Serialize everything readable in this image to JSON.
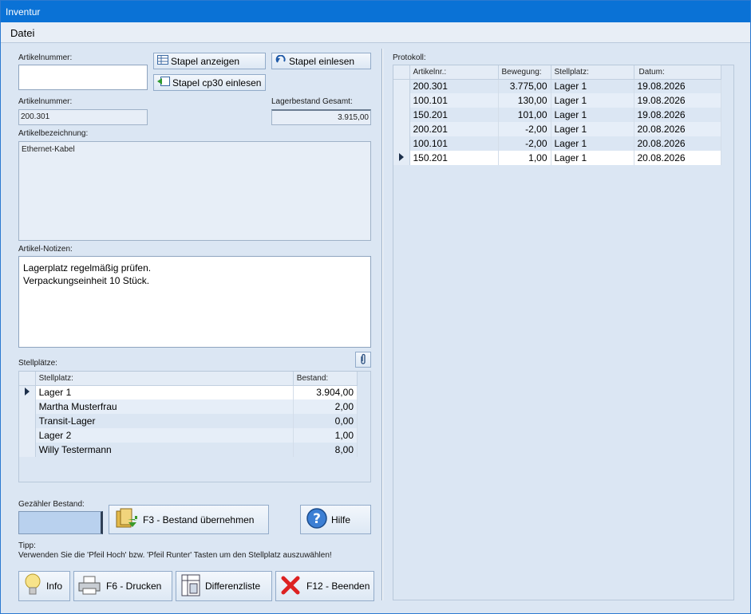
{
  "window": {
    "title": "Inventur"
  },
  "menu": {
    "datei": "Datei"
  },
  "left": {
    "artikelnummer_input_label": "Artikelnummer:",
    "btn_stapel_anzeigen": "Stapel anzeigen",
    "btn_stapel_einlesen": "Stapel einlesen",
    "btn_stapel_cp30": "Stapel cp30 einlesen",
    "artikelnummer_label": "Artikelnummer:",
    "artikelnummer_value": "200.301",
    "lagerbestand_label": "Lagerbestand Gesamt:",
    "lagerbestand_value": "3.915,00",
    "bezeichnung_label": "Artikelbezeichnung:",
    "bezeichnung_value": "Ethernet-Kabel",
    "notizen_label": "Artikel-Notizen:",
    "notizen_value": "Lagerplatz regelmäßig prüfen.\nVerpackungseinheit 10 Stück.",
    "stellplaetze_label": "Stellplätze:",
    "stellplaetze_columns": [
      "Stellplatz:",
      "Bestand:"
    ],
    "stellplaetze_rows": [
      {
        "stellplatz": "Lager 1",
        "bestand": "3.904,00"
      },
      {
        "stellplatz": "Martha Musterfrau",
        "bestand": "2,00"
      },
      {
        "stellplatz": "Transit-Lager",
        "bestand": "0,00"
      },
      {
        "stellplatz": "Lager 2",
        "bestand": "1,00"
      },
      {
        "stellplatz": "Willy Testermann",
        "bestand": "8,00"
      }
    ],
    "gezaehlt_label": "Gezähler Bestand:",
    "btn_f3": "F3 - Bestand übernehmen",
    "btn_hilfe": "Hilfe",
    "tipp_title": "Tipp:",
    "tipp_text": "Verwenden Sie die 'Pfeil Hoch' bzw. 'Pfeil Runter' Tasten um den Stellplatz auszuwählen!",
    "btn_info": "Info",
    "btn_f6": "F6 - Drucken",
    "btn_differenz": "Differenzliste",
    "btn_f12": "F12 - Beenden"
  },
  "right": {
    "protokoll_label": "Protokoll:",
    "columns": [
      "Artikelnr.:",
      "Bewegung:",
      "Stellplatz:",
      "Datum:"
    ],
    "rows": [
      {
        "artikelnr": "200.301",
        "bewegung": "3.775,00",
        "stellplatz": "Lager 1",
        "datum": "19.08.2026"
      },
      {
        "artikelnr": "100.101",
        "bewegung": "130,00",
        "stellplatz": "Lager 1",
        "datum": "19.08.2026"
      },
      {
        "artikelnr": "150.201",
        "bewegung": "101,00",
        "stellplatz": "Lager 1",
        "datum": "19.08.2026"
      },
      {
        "artikelnr": "200.201",
        "bewegung": "-2,00",
        "stellplatz": "Lager 1",
        "datum": "20.08.2026"
      },
      {
        "artikelnr": "100.101",
        "bewegung": "-2,00",
        "stellplatz": "Lager 1",
        "datum": "20.08.2026"
      },
      {
        "artikelnr": "150.201",
        "bewegung": "1,00",
        "stellplatz": "Lager 1",
        "datum": "20.08.2026"
      }
    ]
  },
  "colors": {
    "titlebar": "#0a72d6",
    "window_bg": "#dbe6f3",
    "counted_field": "#b9d1ee"
  }
}
